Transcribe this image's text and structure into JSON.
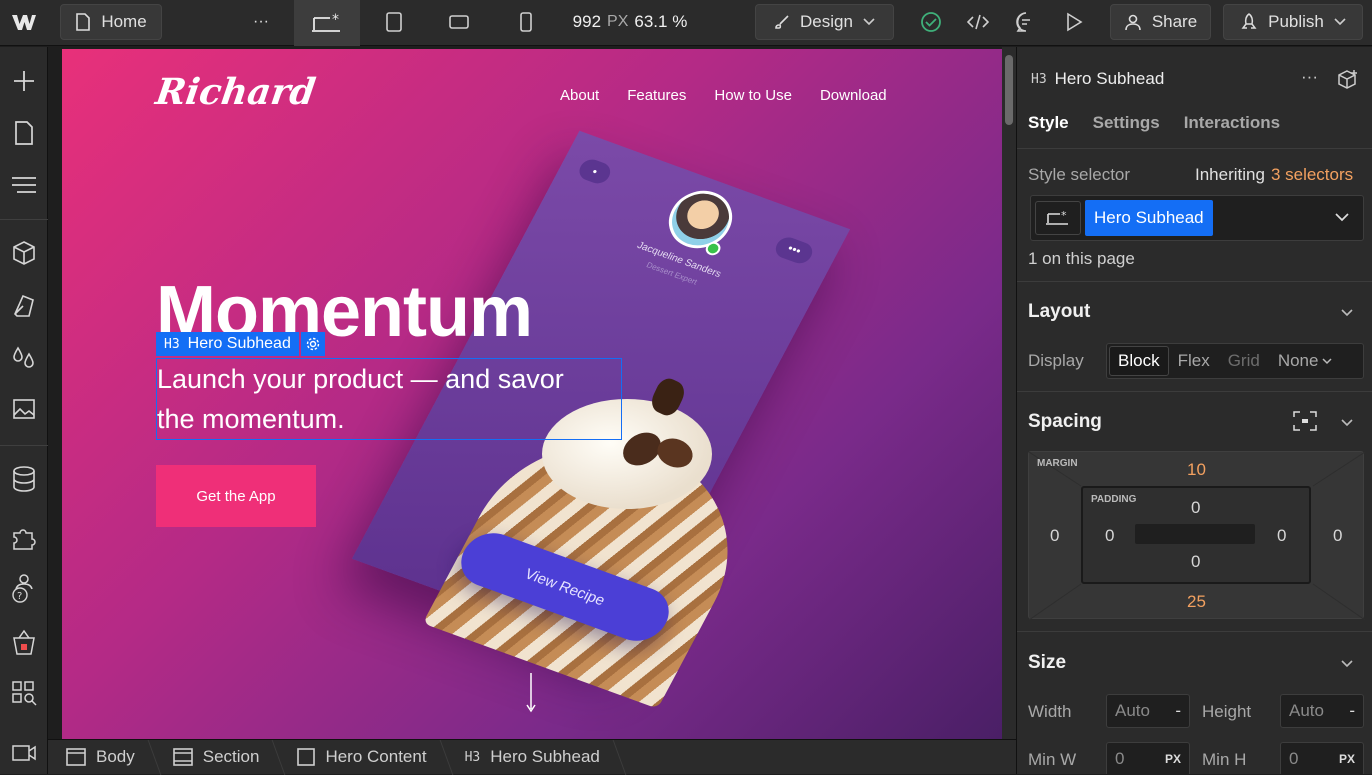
{
  "topbar": {
    "page_label": "Home",
    "more": "···",
    "width_px": "992",
    "width_unit": "PX",
    "zoom": "63.1 %",
    "mode_label": "Design",
    "share_label": "Share",
    "publish_label": "Publish"
  },
  "site": {
    "logo": "Richard",
    "nav": [
      "About",
      "Features",
      "How to Use",
      "Download"
    ],
    "hero_title": "Momentum",
    "hero_sub_line1": "Launch your product — and savor",
    "hero_sub_line2": "the momentum.",
    "cta": "Get the App",
    "card_name": "Jacqueline Sanders",
    "card_role": "Dessert Expert",
    "card_button": "View Recipe"
  },
  "selection": {
    "tag": "H3",
    "label": "Hero Subhead"
  },
  "breadcrumb": [
    {
      "icon": "body-icon",
      "label": "Body"
    },
    {
      "icon": "section-icon",
      "label": "Section"
    },
    {
      "icon": "div-icon",
      "label": "Hero Content"
    },
    {
      "icon": "h3-icon",
      "label": "Hero Subhead",
      "prefix": "H3"
    }
  ],
  "panel": {
    "element_tag": "H3",
    "element_name": "Hero Subhead",
    "tabs": [
      "Style",
      "Settings",
      "Interactions"
    ],
    "style_selector_label": "Style selector",
    "inheriting_prefix": "Inheriting",
    "inheriting_count": "3 selectors",
    "selector_chip": "Hero Subhead",
    "on_page": "1 on this page",
    "layout": {
      "title": "Layout",
      "display_label": "Display",
      "options": [
        "Block",
        "Flex",
        "Grid",
        "None"
      ],
      "active": "Block"
    },
    "spacing": {
      "title": "Spacing",
      "margin_label": "MARGIN",
      "padding_label": "PADDING",
      "margin": {
        "top": "10",
        "right": "0",
        "bottom": "25",
        "left": "0"
      },
      "padding": {
        "top": "0",
        "right": "0",
        "bottom": "0",
        "left": "0"
      }
    },
    "size": {
      "title": "Size",
      "width_label": "Width",
      "width_value": "Auto",
      "width_unit": "-",
      "height_label": "Height",
      "height_value": "Auto",
      "height_unit": "-",
      "minw_label": "Min W",
      "minw_value": "0",
      "minw_unit": "PX",
      "minh_label": "Min H",
      "minh_value": "0",
      "minh_unit": "PX"
    }
  },
  "colors": {
    "accent": "#146ef5",
    "orange": "#f3a160",
    "cta": "#ef2f78",
    "card": "#6a3c9c",
    "view_recipe": "#4b3fd6"
  }
}
